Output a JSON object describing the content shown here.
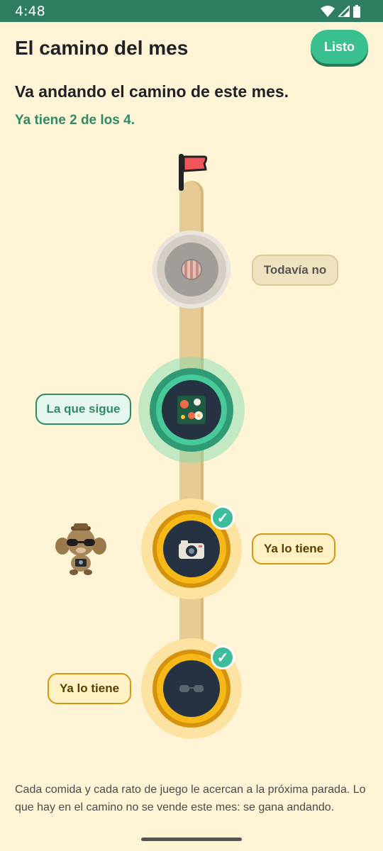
{
  "status_bar": {
    "time": "4:48"
  },
  "header": {
    "title": "El camino del mes",
    "done_label": "Listo"
  },
  "subtitle": "Va andando el camino de este mes.",
  "progress_text": "Ya tiene 2 de los 4.",
  "path": {
    "stops": [
      {
        "state": "locked",
        "label": "Todavía no",
        "icon": "striped-coin-icon"
      },
      {
        "state": "next",
        "label": "La que sigue",
        "icon": "flower-rug-icon"
      },
      {
        "state": "collected",
        "label": "Ya lo tiene",
        "icon": "camera-icon"
      },
      {
        "state": "collected",
        "label": "Ya lo tiene",
        "icon": "sunglasses-icon"
      }
    ],
    "end_marker": "flag-icon",
    "pet": "pet-character"
  },
  "footer_text": "Cada comida y cada rato de juego le acercan a la próxima parada. Lo que hay en el camino no se vende este mes: se gana andando.",
  "colors": {
    "background": "#FFF4D6",
    "status_bar": "#2E7D5E",
    "accent_green": "#39C08E",
    "gold": "#F6B917",
    "locked_gray": "#CFCAC2"
  }
}
